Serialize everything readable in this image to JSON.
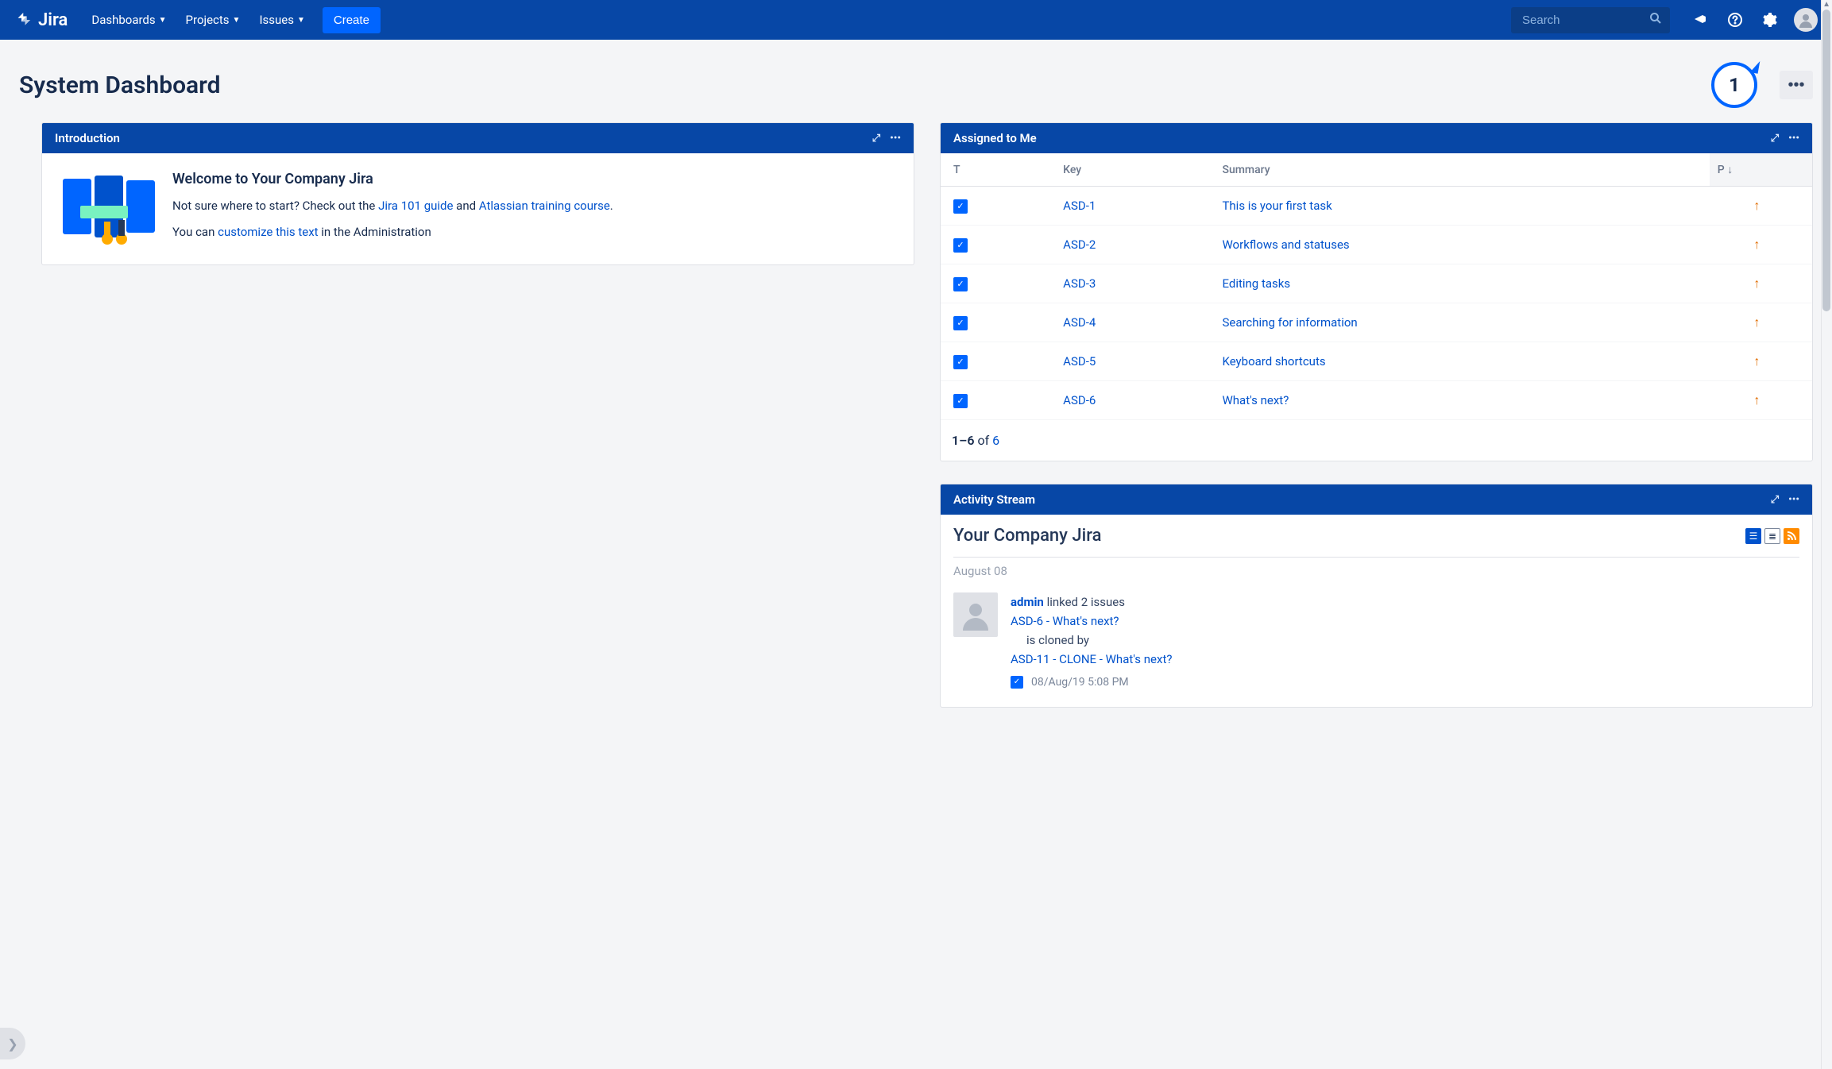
{
  "nav": {
    "brand": "Jira",
    "dashboards": "Dashboards",
    "projects": "Projects",
    "issues": "Issues",
    "create": "Create",
    "search_placeholder": "Search"
  },
  "page": {
    "title": "System Dashboard",
    "badge_number": "1"
  },
  "intro": {
    "header": "Introduction",
    "heading": "Welcome to Your Company Jira",
    "line1_pre": "Not sure where to start? Check out the ",
    "link1": "Jira 101 guide",
    "line1_mid": " and ",
    "link2": "Atlassian training course",
    "line1_post": ".",
    "line2_pre": "You can ",
    "link3": "customize this text",
    "line2_post": " in the Administration"
  },
  "assigned": {
    "header": "Assigned to Me",
    "columns": {
      "t": "T",
      "key": "Key",
      "summary": "Summary",
      "p": "P"
    },
    "rows": [
      {
        "key": "ASD-1",
        "summary": "This is your first task"
      },
      {
        "key": "ASD-2",
        "summary": "Workflows and statuses"
      },
      {
        "key": "ASD-3",
        "summary": "Editing tasks"
      },
      {
        "key": "ASD-4",
        "summary": "Searching for information"
      },
      {
        "key": "ASD-5",
        "summary": "Keyboard shortcuts"
      },
      {
        "key": "ASD-6",
        "summary": "What's next?"
      }
    ],
    "pagination": {
      "range": "1–6",
      "of": " of ",
      "total": "6"
    }
  },
  "activity": {
    "header": "Activity Stream",
    "title": "Your Company Jira",
    "date": "August 08",
    "item": {
      "user": "admin",
      "action": " linked 2 issues",
      "link1": "ASD-6 - What's next?",
      "rel": "is cloned by",
      "link2": "ASD-11 - CLONE - What's next?",
      "timestamp": "08/Aug/19 5:08 PM"
    }
  }
}
